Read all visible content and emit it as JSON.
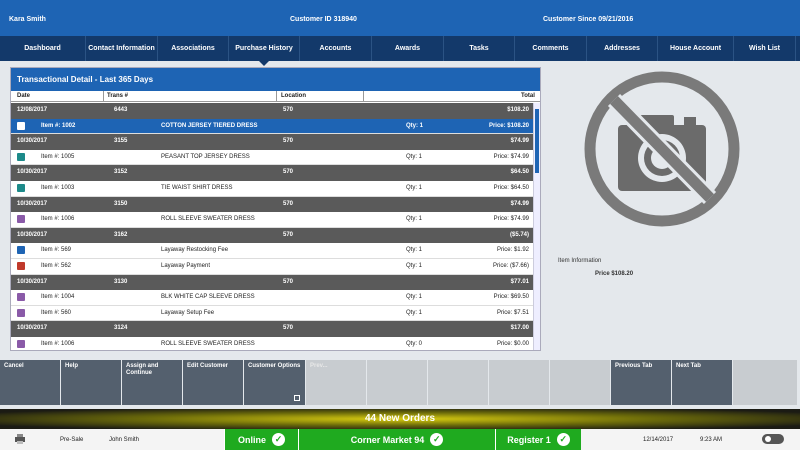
{
  "header": {
    "customer_name": "Kara Smith",
    "customer_id_label": "Customer ID",
    "customer_id": "318940",
    "since_label": "Customer Since",
    "since_date": "09/21/2016"
  },
  "tabs": [
    {
      "label": "Dashboard"
    },
    {
      "label": "Contact Information"
    },
    {
      "label": "Associations"
    },
    {
      "label": "Purchase History",
      "active": true
    },
    {
      "label": "Accounts"
    },
    {
      "label": "Awards"
    },
    {
      "label": "Tasks"
    },
    {
      "label": "Comments"
    },
    {
      "label": "Addresses"
    },
    {
      "label": "House Account"
    },
    {
      "label": "Wish List"
    }
  ],
  "panel": {
    "title": "Transactional Detail - Last 365 Days",
    "columns": [
      "Date",
      "Trans #",
      "Location",
      "Total"
    ]
  },
  "rows": [
    {
      "kind": "txn",
      "date": "12/08/2017",
      "trans": "6443",
      "location": "570",
      "total": "$108.20"
    },
    {
      "kind": "item",
      "icon": "bag",
      "selected": true,
      "item": "Item #: 1002",
      "desc": "COTTON JERSEY TIERED DRESS",
      "qty": "Qty: 1",
      "price": "Price: $108.20"
    },
    {
      "kind": "txn",
      "date": "10/30/2017",
      "trans": "3155",
      "location": "570",
      "total": "$74.99"
    },
    {
      "kind": "item",
      "icon": "go",
      "item": "Item #: 1005",
      "desc": "PEASANT TOP JERSEY DRESS",
      "qty": "Qty: 1",
      "price": "Price: $74.99"
    },
    {
      "kind": "txn",
      "date": "10/30/2017",
      "trans": "3152",
      "location": "570",
      "total": "$64.50"
    },
    {
      "kind": "item",
      "icon": "go",
      "item": "Item #: 1003",
      "desc": "TIE WAIST SHIRT DRESS",
      "qty": "Qty: 1",
      "price": "Price: $64.50"
    },
    {
      "kind": "txn",
      "date": "10/30/2017",
      "trans": "3150",
      "location": "570",
      "total": "$74.99"
    },
    {
      "kind": "item",
      "icon": "pk",
      "item": "Item #: 1006",
      "desc": "ROLL SLEEVE SWEATER DRESS",
      "qty": "Qty: 1",
      "price": "Price: $74.99"
    },
    {
      "kind": "txn",
      "date": "10/30/2017",
      "trans": "3162",
      "location": "570",
      "total": "($5.74)"
    },
    {
      "kind": "item",
      "icon": "bag",
      "item": "Item #: 569",
      "desc": "Layaway Restocking Fee",
      "qty": "Qty: 1",
      "price": "Price: $1.92"
    },
    {
      "kind": "item",
      "icon": "rt",
      "item": "Item #: 562",
      "desc": "Layaway Payment",
      "qty": "Qty: 1",
      "price": "Price: ($7.66)"
    },
    {
      "kind": "txn",
      "date": "10/30/2017",
      "trans": "3130",
      "location": "570",
      "total": "$77.01"
    },
    {
      "kind": "item",
      "icon": "pk",
      "item": "Item #: 1004",
      "desc": "BLK WHITE CAP SLEEVE DRESS",
      "qty": "Qty: 1",
      "price": "Price: $69.50"
    },
    {
      "kind": "item",
      "icon": "pk",
      "item": "Item #: 560",
      "desc": "Layaway Setup Fee",
      "qty": "Qty: 1",
      "price": "Price: $7.51"
    },
    {
      "kind": "txn",
      "date": "10/30/2017",
      "trans": "3124",
      "location": "570",
      "total": "$17.00"
    },
    {
      "kind": "item",
      "icon": "pk",
      "item": "Item #: 1006",
      "desc": "ROLL SLEEVE SWEATER DRESS",
      "qty": "Qty: 0",
      "price": "Price: $0.00"
    }
  ],
  "item_panel": {
    "info_label": "Item Information",
    "price": "Price $108.20"
  },
  "buttons": [
    {
      "label": "Cancel",
      "style": "dark"
    },
    {
      "label": "Help",
      "style": "dark"
    },
    {
      "label": "Assign and Continue",
      "style": "dark"
    },
    {
      "label": "Edit Customer",
      "style": "dark"
    },
    {
      "label": "Customer Options",
      "style": "dark",
      "menu": true
    },
    {
      "label": "Prev...",
      "style": "light"
    },
    {
      "label": "",
      "style": "light"
    },
    {
      "label": "",
      "style": "light"
    },
    {
      "label": "",
      "style": "light"
    },
    {
      "label": "",
      "style": "light"
    },
    {
      "label": "Previous Tab",
      "style": "dark"
    },
    {
      "label": "Next Tab",
      "style": "dark"
    },
    {
      "label": "",
      "style": "light"
    }
  ],
  "orders_banner": "44 New Orders",
  "status": {
    "mode": "Pre-Sale",
    "user": "John Smith",
    "online": "Online",
    "store": "Corner Market 94",
    "register": "Register 1",
    "date": "12/14/2017",
    "time": "9:23 AM"
  },
  "colors": {
    "header_blue": "#1e64b4",
    "tab_navy": "#13396a",
    "txn_gray": "#5a5a5a",
    "status_green": "#1faa1f"
  }
}
